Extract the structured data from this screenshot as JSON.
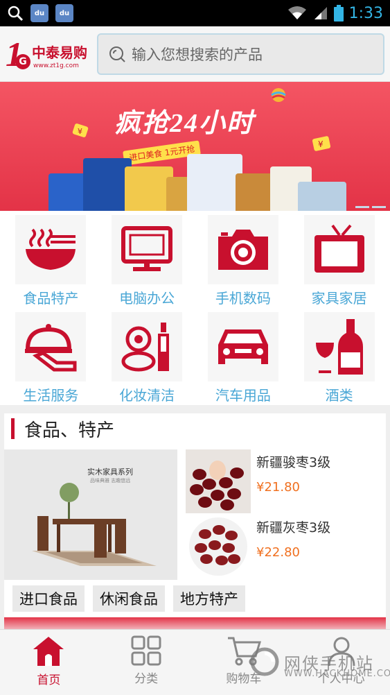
{
  "status_bar": {
    "time": "1:33",
    "notification_icons": [
      "search-icon",
      "baidu-icon",
      "baidu-icon"
    ],
    "app_badge": "du"
  },
  "header": {
    "logo": {
      "number": "1",
      "letter": "G",
      "brand": "中泰易购",
      "url": "www.zt1g.com"
    },
    "search_placeholder": "输入您想搜索的产品"
  },
  "banner": {
    "title": "疯抢24小时",
    "subtitle": "进口美食 1元开抢",
    "pages": 2,
    "active_page": 1
  },
  "categories": [
    {
      "label": "食品特产",
      "icon": "noodle-bowl-icon"
    },
    {
      "label": "电脑办公",
      "icon": "monitor-icon"
    },
    {
      "label": "手机数码",
      "icon": "camera-icon"
    },
    {
      "label": "家具家居",
      "icon": "tv-icon"
    },
    {
      "label": "生活服务",
      "icon": "service-tray-icon"
    },
    {
      "label": "化妆清洁",
      "icon": "cosmetics-icon"
    },
    {
      "label": "汽车用品",
      "icon": "car-icon"
    },
    {
      "label": "酒类",
      "icon": "wine-icon"
    }
  ],
  "section": {
    "title": "食品、特产",
    "feature": {
      "title": "实木家具系列",
      "subtitle": "品味典雅 志趣悠远"
    },
    "items": [
      {
        "name": "新疆骏枣3级",
        "price": "¥21.80"
      },
      {
        "name": "新疆灰枣3级",
        "price": "¥22.80"
      }
    ],
    "tags": [
      "进口食品",
      "休闲食品",
      "地方特产"
    ]
  },
  "tabbar": [
    {
      "label": "首页",
      "icon": "home-icon",
      "active": true
    },
    {
      "label": "分类",
      "icon": "grid-icon",
      "active": false
    },
    {
      "label": "购物车",
      "icon": "cart-icon",
      "active": false
    },
    {
      "label": "个人中心",
      "icon": "user-icon",
      "active": false
    }
  ],
  "watermark": {
    "text": "网侠手机站",
    "url": "WWW.HACKHOME.COM"
  },
  "colors": {
    "brand_red": "#c8102e",
    "label_blue": "#4aa7d6",
    "price_orange": "#f07020"
  }
}
